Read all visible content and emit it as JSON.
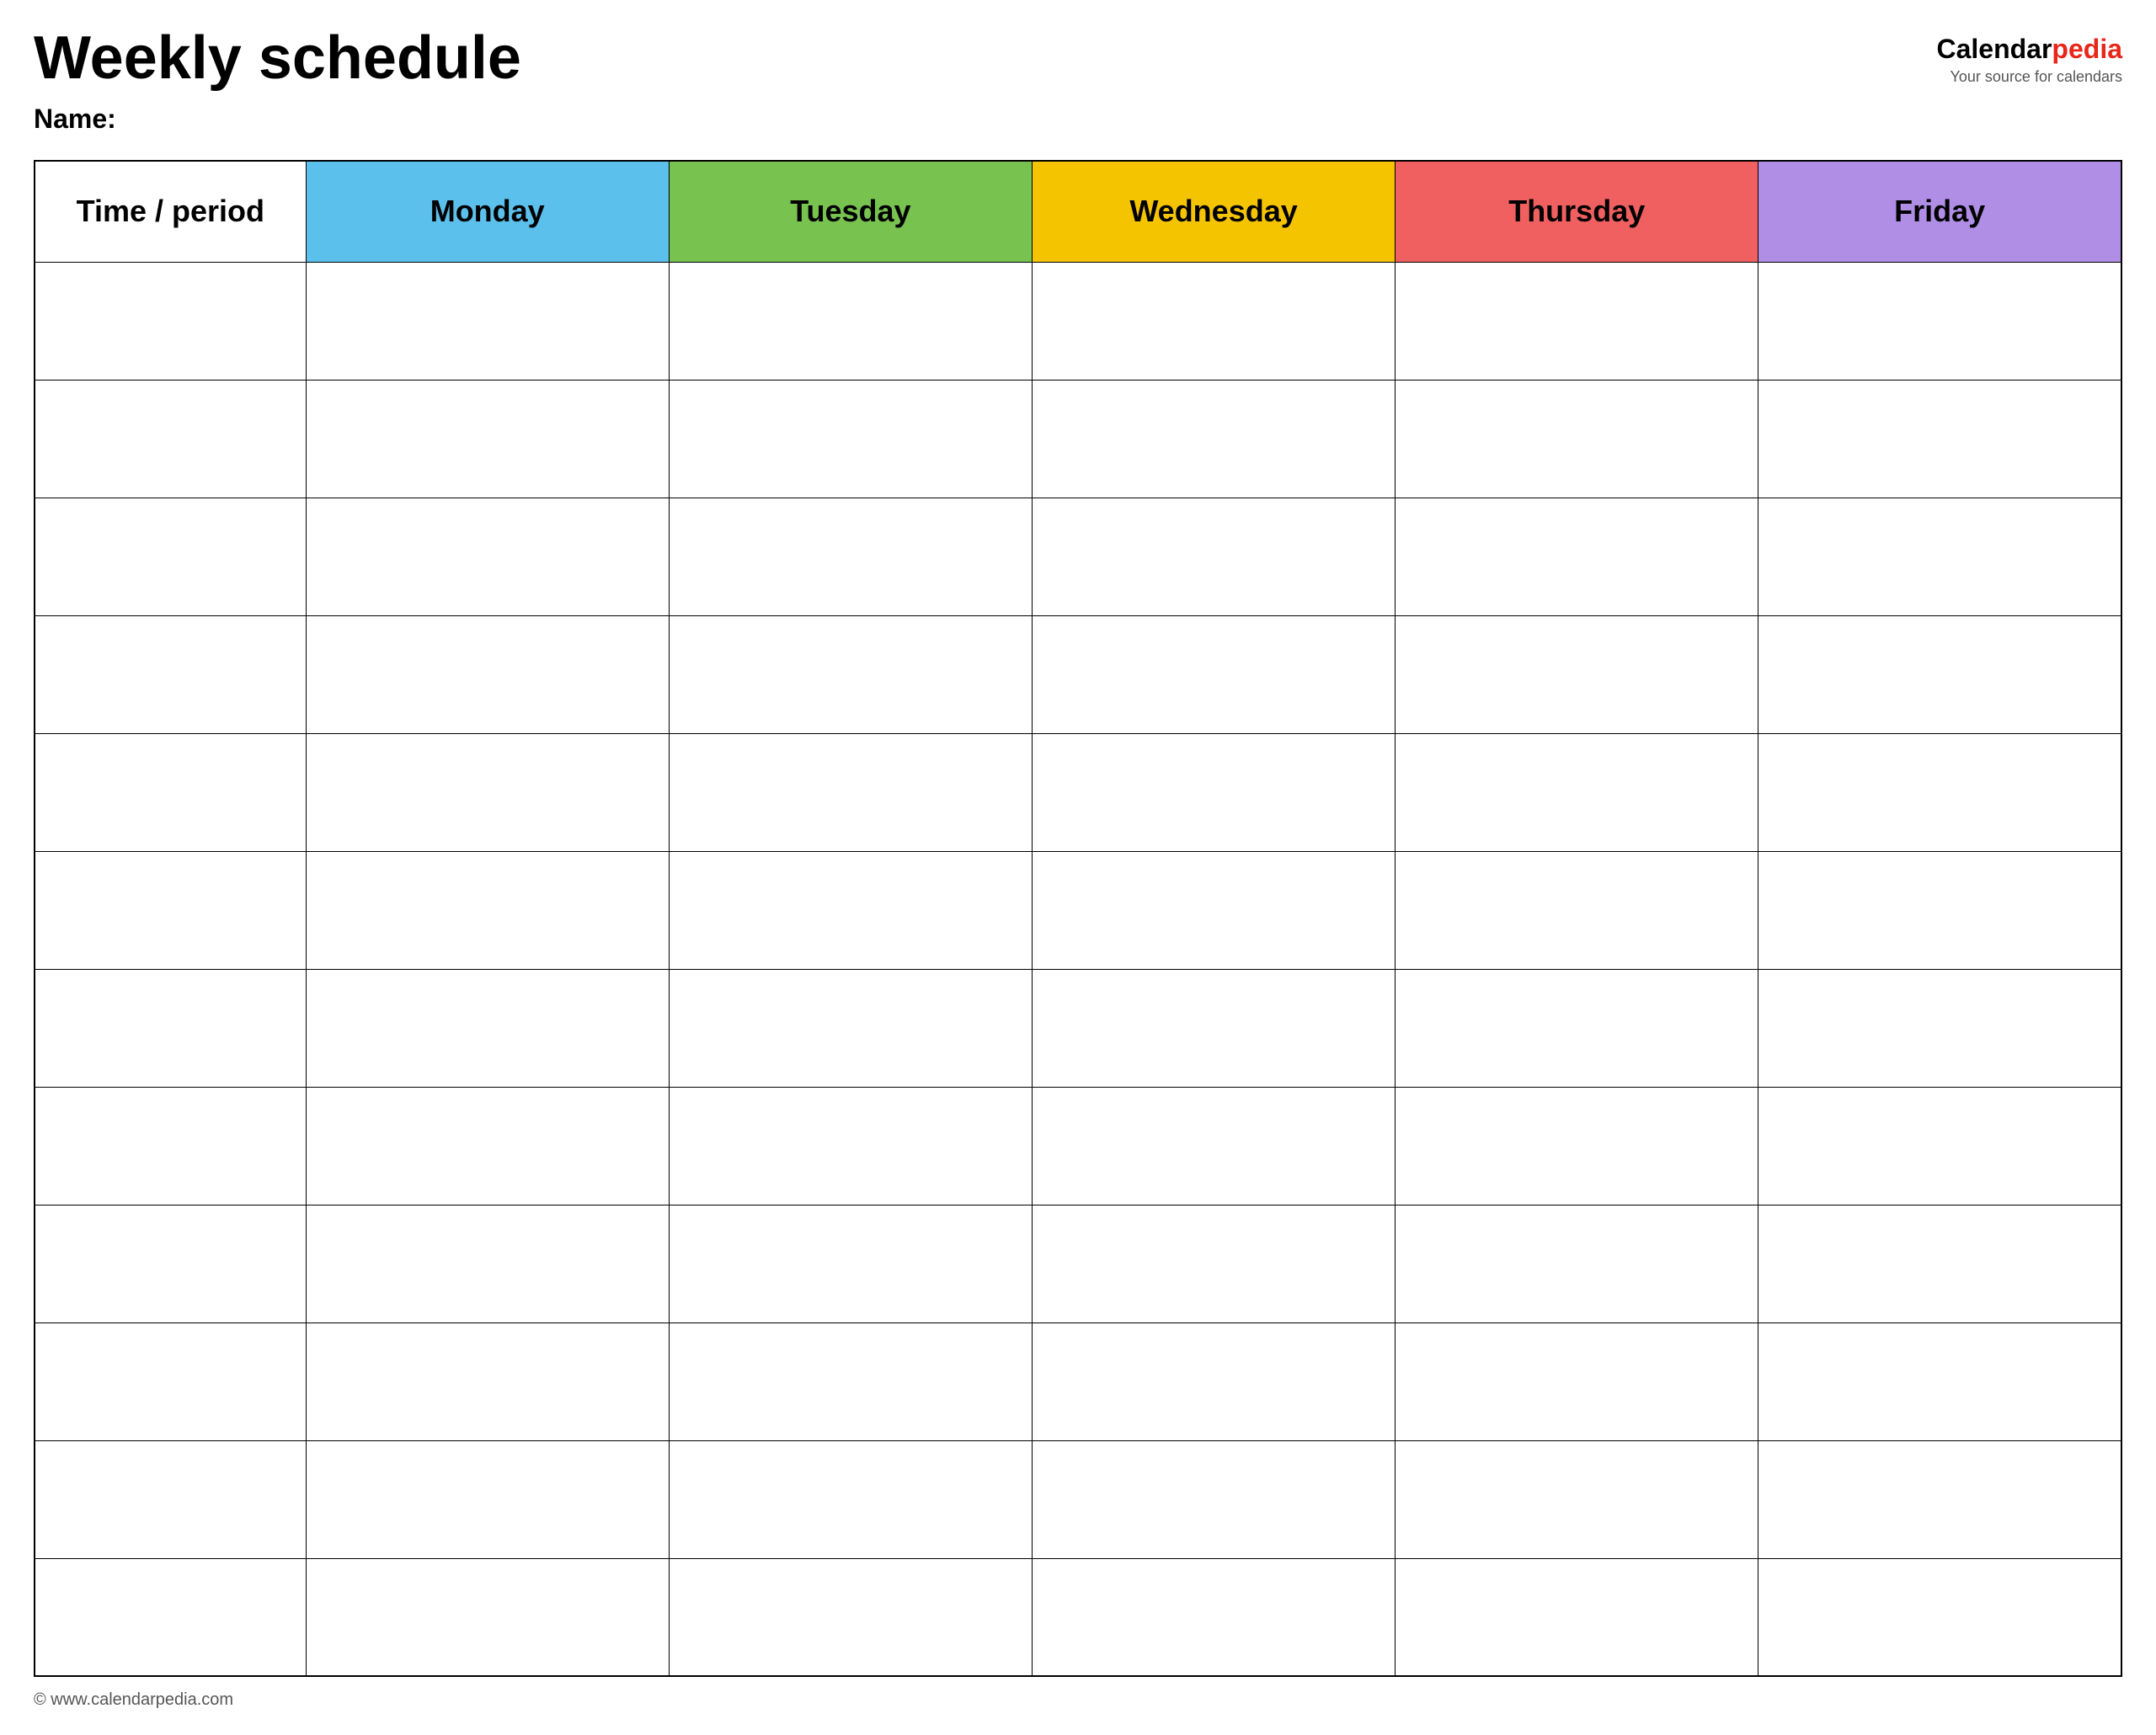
{
  "header": {
    "title": "Weekly schedule",
    "name_label": "Name:",
    "logo": {
      "calendar": "Calendar",
      "pedia": "pedia",
      "tagline": "Your source for calendars"
    }
  },
  "table": {
    "columns": [
      {
        "key": "time",
        "label": "Time / period",
        "color": "#ffffff"
      },
      {
        "key": "monday",
        "label": "Monday",
        "color": "#5bc0eb"
      },
      {
        "key": "tuesday",
        "label": "Tuesday",
        "color": "#78c250"
      },
      {
        "key": "wednesday",
        "label": "Wednesday",
        "color": "#f5c400"
      },
      {
        "key": "thursday",
        "label": "Thursday",
        "color": "#f06060"
      },
      {
        "key": "friday",
        "label": "Friday",
        "color": "#b08ee6"
      }
    ],
    "row_count": 12
  },
  "footer": {
    "url": "© www.calendarpedia.com"
  }
}
